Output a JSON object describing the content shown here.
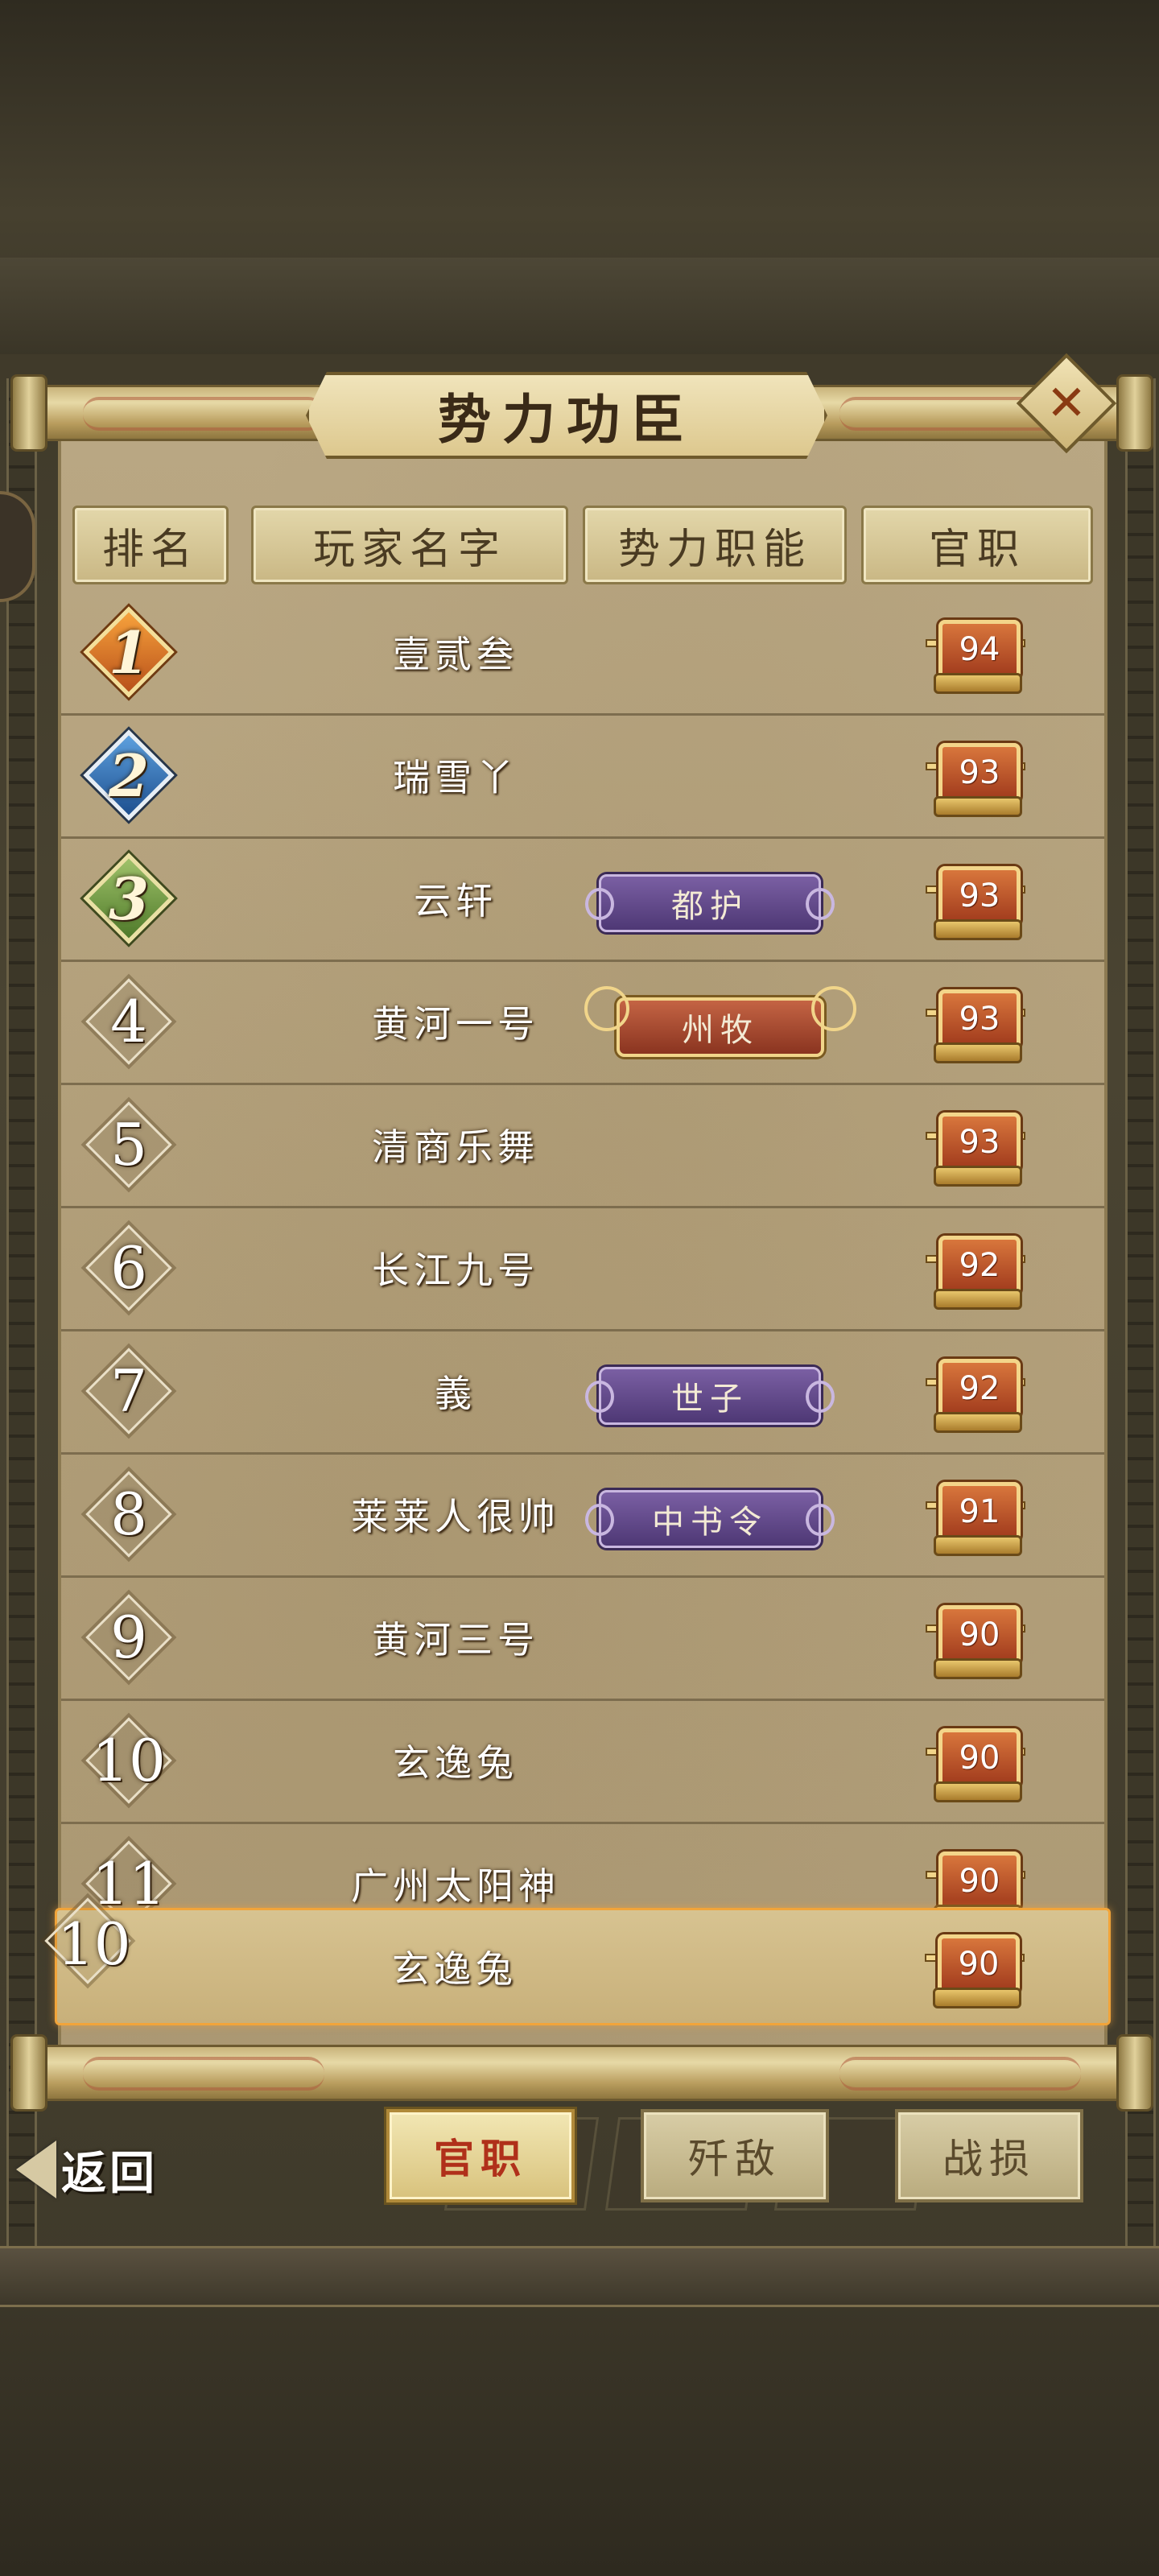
{
  "window": {
    "title": "势力功臣",
    "close_label": "✕"
  },
  "columns": [
    "排名",
    "玩家名字",
    "势力职能",
    "官职"
  ],
  "rows": [
    {
      "rank": "1",
      "name": "壹贰叁",
      "role": "",
      "role_style": "",
      "level": "94",
      "medal": "gold"
    },
    {
      "rank": "2",
      "name": "瑞雪丫",
      "role": "",
      "role_style": "",
      "level": "93",
      "medal": "silver"
    },
    {
      "rank": "3",
      "name": "云轩",
      "role": "都护",
      "role_style": "purple",
      "level": "93",
      "medal": "bronze"
    },
    {
      "rank": "4",
      "name": "黄河一号",
      "role": "州牧",
      "role_style": "red",
      "level": "93",
      "medal": "plain"
    },
    {
      "rank": "5",
      "name": "清商乐舞",
      "role": "",
      "role_style": "",
      "level": "93",
      "medal": "plain"
    },
    {
      "rank": "6",
      "name": "长江九号",
      "role": "",
      "role_style": "",
      "level": "92",
      "medal": "plain"
    },
    {
      "rank": "7",
      "name": "義",
      "role": "世子",
      "role_style": "purple",
      "level": "92",
      "medal": "plain"
    },
    {
      "rank": "8",
      "name": "莱莱人很帅",
      "role": "中书令",
      "role_style": "purple",
      "level": "91",
      "medal": "plain"
    },
    {
      "rank": "9",
      "name": "黄河三号",
      "role": "",
      "role_style": "",
      "level": "90",
      "medal": "plain"
    },
    {
      "rank": "10",
      "name": "玄逸兔",
      "role": "",
      "role_style": "",
      "level": "90",
      "medal": "plain"
    },
    {
      "rank": "11",
      "name": "广州太阳神",
      "role": "",
      "role_style": "",
      "level": "90",
      "medal": "plain"
    }
  ],
  "self_row": {
    "rank": "10",
    "name": "玄逸兔",
    "level": "90"
  },
  "bottom": {
    "back_label": "返回",
    "tabs": [
      {
        "label": "官职",
        "active": true
      },
      {
        "label": "歼敌",
        "active": false
      },
      {
        "label": "战损",
        "active": false
      }
    ]
  },
  "colors": {
    "active_tab_text": "#b0301a",
    "self_row_border": "#f1a43a",
    "role_purple": "#5e4488",
    "role_red": "#a44a2e"
  }
}
